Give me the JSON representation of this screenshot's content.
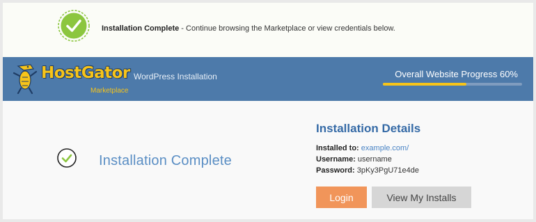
{
  "notice": {
    "icon": "check-circle-icon",
    "title": "Installation Complete",
    "message": " - Continue browsing the Marketplace or view credentials below."
  },
  "header": {
    "brand": "HostGator",
    "subtitle": "WordPress Installation",
    "section": "Marketplace",
    "progress_label": "Overall Website Progress 60%",
    "progress_fraction": 0.6,
    "accent_color": "#f7c419",
    "background_color": "#4d7aaa"
  },
  "main": {
    "status_title": "Installation Complete",
    "details": {
      "title": "Installation Details",
      "installed_to_label": "Installed to:",
      "installed_to_value": "example.com/",
      "username_label": "Username:",
      "username_value": "username",
      "password_label": "Password:",
      "password_value": "3pKy3PgU71e4de"
    },
    "buttons": {
      "login": "Login",
      "view_installs": "View My Installs"
    }
  }
}
